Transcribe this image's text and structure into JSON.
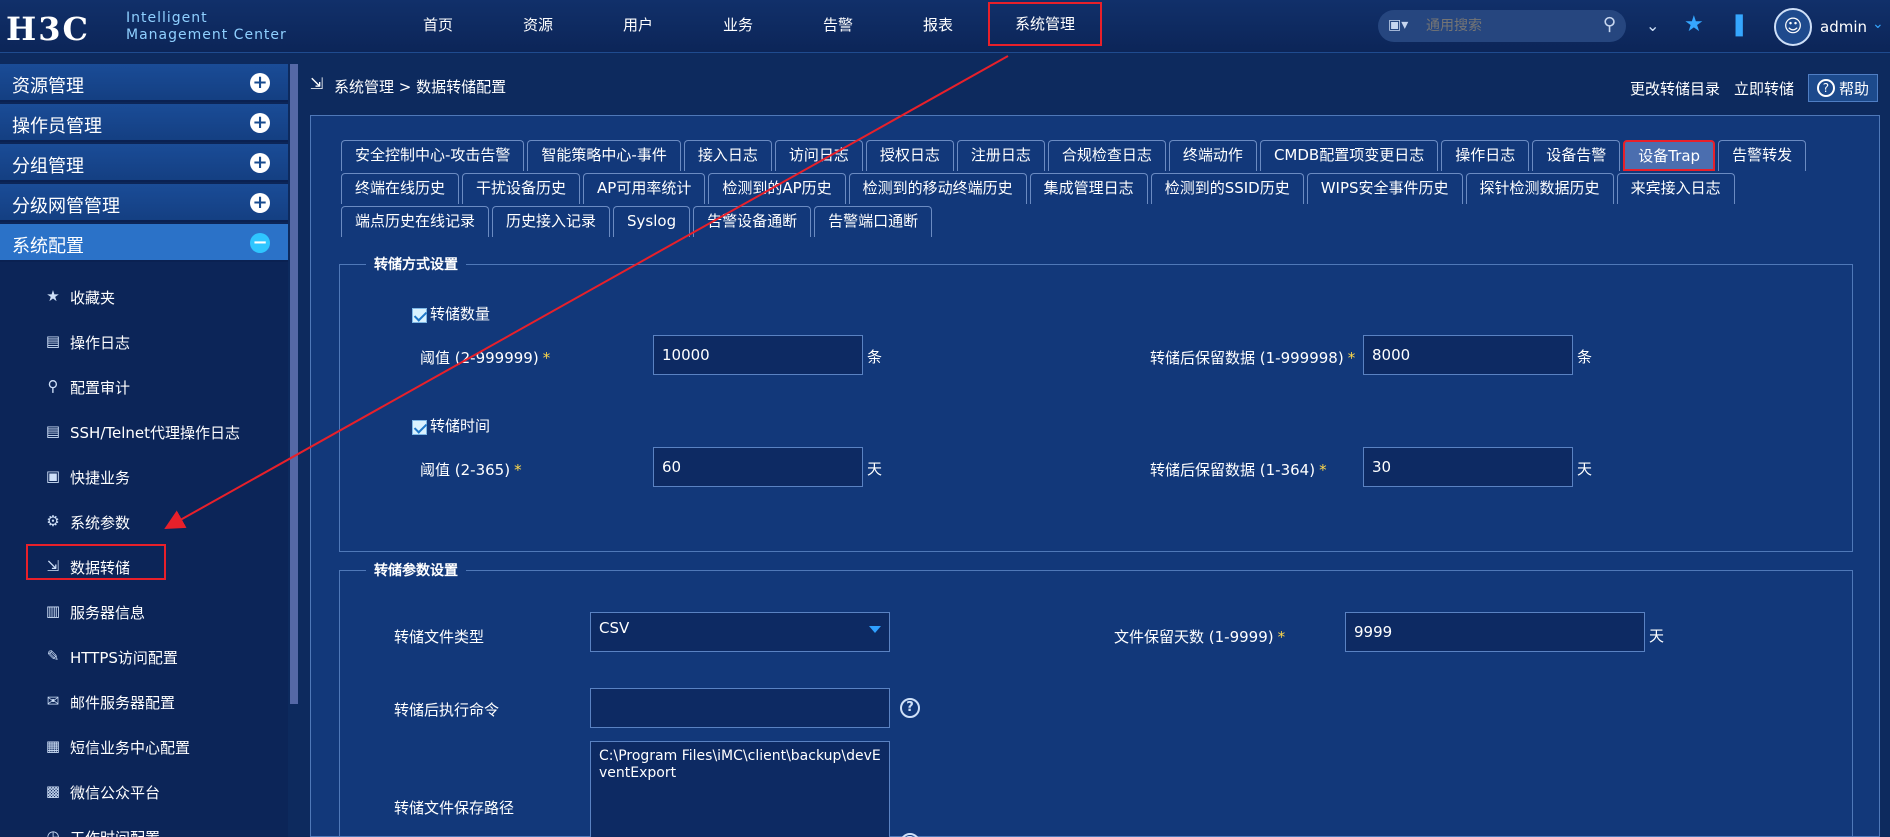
{
  "header": {
    "logo_mark": "H3C",
    "logo_line1": "Intelligent",
    "logo_line2": "Management Center",
    "nav": [
      "首页",
      "资源",
      "用户",
      "业务",
      "告警",
      "报表",
      "系统管理"
    ],
    "active_nav": "系统管理",
    "search_placeholder": "通用搜索",
    "user": "admin"
  },
  "sidebar": {
    "groups": [
      "资源管理",
      "操作员管理",
      "分组管理",
      "分级网管管理",
      "系统配置"
    ],
    "open_group": "系统配置",
    "items": [
      {
        "label": "收藏夹",
        "icon": "star-icon"
      },
      {
        "label": "操作日志",
        "icon": "clipboard-icon"
      },
      {
        "label": "配置审计",
        "icon": "magnifier-icon"
      },
      {
        "label": "SSH/Telnet代理操作日志",
        "icon": "clipboard-icon"
      },
      {
        "label": "快捷业务",
        "icon": "id-card-icon"
      },
      {
        "label": "系统参数",
        "icon": "gear-icon"
      },
      {
        "label": "数据转储",
        "icon": "export-icon"
      },
      {
        "label": "服务器信息",
        "icon": "server-icon"
      },
      {
        "label": "HTTPS访问配置",
        "icon": "edit-icon"
      },
      {
        "label": "邮件服务器配置",
        "icon": "mail-gear-icon"
      },
      {
        "label": "短信业务中心配置",
        "icon": "sms-gear-icon"
      },
      {
        "label": "微信公众平台",
        "icon": "wechat-gear-icon"
      },
      {
        "label": "工作时间配置",
        "icon": "clock-icon"
      }
    ],
    "active_item": "数据转储"
  },
  "breadcrumb": {
    "text": "系统管理 > 数据转储配置",
    "link_change_dir": "更改转储目录",
    "link_dump_now": "立即转储",
    "help": "帮助"
  },
  "tabs": {
    "row1": [
      "安全控制中心-攻击告警",
      "智能策略中心-事件",
      "接入日志",
      "访问日志",
      "授权日志",
      "注册日志",
      "合规检查日志",
      "终端动作",
      "CMDB配置项变更日志",
      "操作日志",
      "设备告警",
      "设备Trap",
      "告警转发"
    ],
    "row2": [
      "终端在线历史",
      "干扰设备历史",
      "AP可用率统计",
      "检测到的AP历史",
      "检测到的移动终端历史",
      "集成管理日志",
      "检测到的SSID历史",
      "WIPS安全事件历史",
      "探针检测数据历史",
      "来宾接入日志"
    ],
    "row3": [
      "端点历史在线记录",
      "历史接入记录",
      "Syslog",
      "告警设备通断",
      "告警端口通断"
    ],
    "active": "设备Trap"
  },
  "dump_mode": {
    "legend": "转储方式设置",
    "by_count": {
      "checked": true,
      "label": "转储数量",
      "threshold_label": "阈值 (2-999999)",
      "threshold_value": "10000",
      "threshold_unit": "条",
      "keep_label": "转储后保留数据 (1-999998)",
      "keep_value": "8000",
      "keep_unit": "条"
    },
    "by_time": {
      "checked": true,
      "label": "转储时间",
      "threshold_label": "阈值 (2-365)",
      "threshold_value": "60",
      "threshold_unit": "天",
      "keep_label": "转储后保留数据 (1-364)",
      "keep_value": "30",
      "keep_unit": "天"
    }
  },
  "dump_params": {
    "legend": "转储参数设置",
    "file_type_label": "转储文件类型",
    "file_type_value": "CSV",
    "retain_days_label": "文件保留天数 (1-9999)",
    "retain_days_value": "9999",
    "retain_days_unit": "天",
    "post_cmd_label": "转储后执行命令",
    "post_cmd_value": "",
    "save_path_label": "转储文件保存路径",
    "save_path_value": "C:\\Program Files\\iMC\\client\\backup\\devEventExport"
  },
  "colors": {
    "accent": "#35a7ff",
    "highlight_box": "#e8202a",
    "panel_bg": "#12387a",
    "required": "#ffd84a"
  }
}
